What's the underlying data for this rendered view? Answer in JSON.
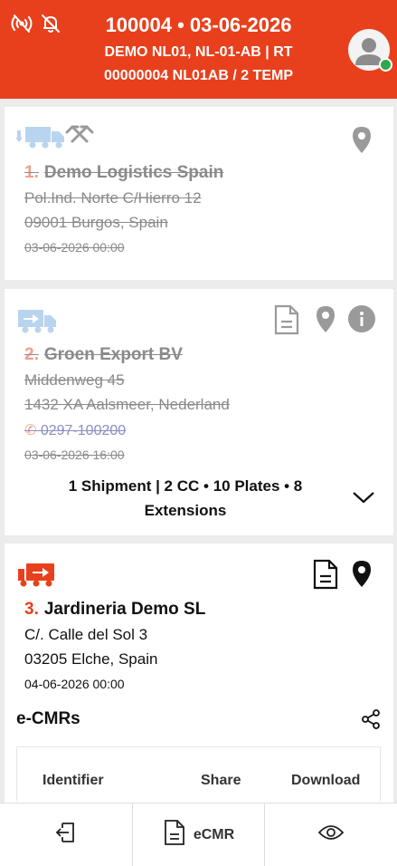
{
  "header": {
    "line1": "100004 • 03-06-2026",
    "line2": "DEMO NL01, NL-01-AB | RT",
    "line3": "00000004 NL01AB / 2 TEMP",
    "bg_color": "#e8401c"
  },
  "stops": [
    {
      "num": "1.",
      "name": "Demo Logistics Spain",
      "addr1": "Pol.Ind. Norte C/Hierro 12",
      "addr2": "09001 Burgos, Spain",
      "date": "03-06-2026 00:00",
      "vehicle_icon": "truck-unload-icon",
      "status": "completed"
    },
    {
      "num": "2.",
      "name": "Groen Export BV",
      "addr1": "Middenweg 45",
      "addr2": "1432 XA Aalsmeer, Nederland",
      "phone": "0297-100200",
      "date": "03-06-2026 16:00",
      "summary": "1 Shipment | 2 CC • 10 Plates • 8 Extensions",
      "vehicle_icon": "truck-load-icon",
      "status": "completed"
    },
    {
      "num": "3.",
      "name": "Jardineria Demo SL",
      "addr1": "C/. Calle del Sol 3",
      "addr2": "03205 Elche, Spain",
      "date": "04-06-2026 00:00",
      "vehicle_icon": "truck-deliver-icon",
      "status": "active"
    }
  ],
  "ecmr": {
    "title": "e-CMRs",
    "columns": [
      "Identifier",
      "Share",
      "Download"
    ]
  },
  "nav": {
    "exit_label": "",
    "ecmr_label": "eCMR",
    "view_label": ""
  }
}
